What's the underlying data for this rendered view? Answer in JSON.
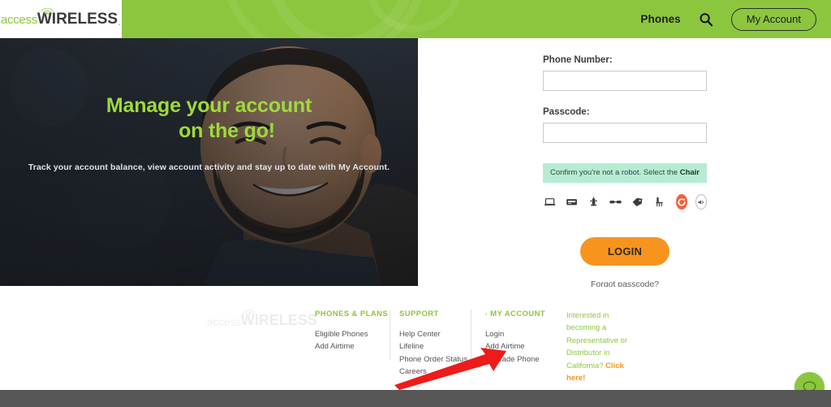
{
  "site": {
    "logo": {
      "part1": "access",
      "part2": "WIRELESS",
      "suffix": ".",
      "icon": "wifi-signal-icon"
    },
    "header_bg": "#8cc63e"
  },
  "header": {
    "nav_phones": "Phones",
    "search_icon": "search-icon",
    "my_account_button": "My Account"
  },
  "hero": {
    "heading_line1": "Manage your account",
    "heading_line2": "on the go!",
    "subtext": "Track your account balance, view account activity and stay up to date with My Account.",
    "heading_color": "#9fd93c"
  },
  "login": {
    "phone_label": "Phone Number:",
    "phone_value": "",
    "phone_placeholder": "",
    "passcode_label": "Passcode:",
    "passcode_value": "",
    "passcode_placeholder": "",
    "captcha_text": "Confirm you're not a robot. Select the ",
    "captcha_target": "Chair",
    "captcha_banner_color": "#b6ecd3",
    "captcha_icons": [
      "laptop-icon",
      "card-reader-icon",
      "fire-hydrant-icon",
      "sunglasses-icon",
      "price-tag-icon",
      "chair-icon"
    ],
    "reload_icon": "reload-icon",
    "audio_icon": "audio-icon",
    "login_button": "LOGIN",
    "login_button_color": "#f7941e",
    "forgot_link": "Forgot passcode?"
  },
  "footer": {
    "columns": [
      {
        "heading": "PHONES & PLANS",
        "icon": null,
        "links": [
          "Eligible Phones",
          "Add Airtime"
        ]
      },
      {
        "heading": "SUPPORT",
        "icon": null,
        "links": [
          "Help Center",
          "Lifeline",
          "Phone Order Status",
          "Careers"
        ]
      },
      {
        "heading": "MY ACCOUNT",
        "icon": "user-icon",
        "links": [
          "Login",
          "Add Airtime",
          "Upgrade Phone"
        ]
      }
    ],
    "promo_text": "Interested in becoming a Representative or Distributor in California? ",
    "promo_cta": "Click here!",
    "promo_color": "#8cc63e",
    "promo_cta_color": "#f7941e"
  },
  "annotation": {
    "arrow_color": "#ee1b1b",
    "points_to": "Upgrade Phone"
  },
  "chat": {
    "icon": "chat-bubble-icon",
    "color": "#8cc63e"
  }
}
